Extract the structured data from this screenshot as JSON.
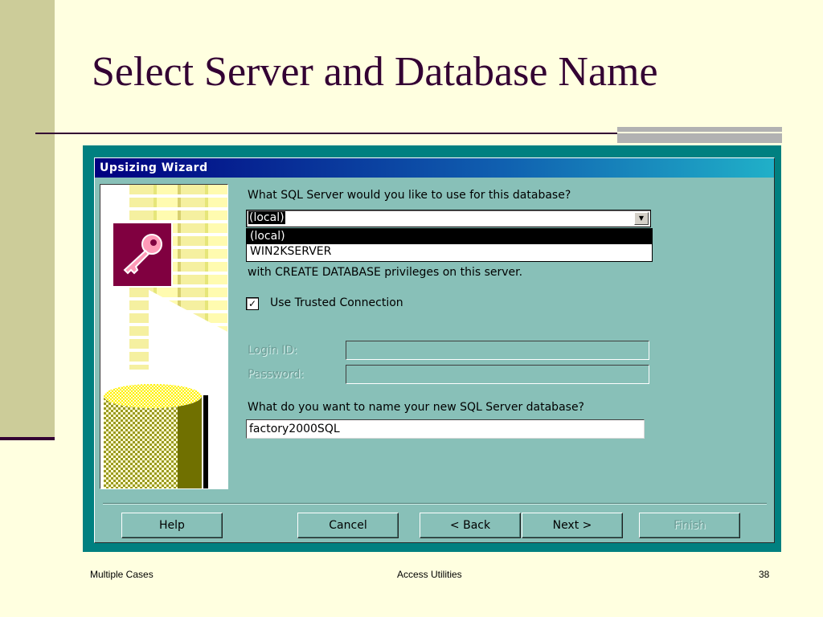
{
  "slide": {
    "title": "Select Server and Database Name",
    "footer_left": "Multiple Cases",
    "footer_center": "Access Utilities",
    "page_number": "38"
  },
  "dialog": {
    "title": "Upsizing  Wizard",
    "server_question": "What SQL Server would you like to use for this database?",
    "server_selected": "(local)",
    "server_options": [
      "(local)",
      "WIN2KSERVER"
    ],
    "privileges_text": "with CREATE DATABASE privileges on this server.",
    "trusted_connection_label": "Use Trusted Connection",
    "trusted_connection_checked": true,
    "login_label": "Login ID:",
    "login_value": "",
    "password_label": "Password:",
    "password_value": "",
    "db_name_question": "What do you want to name your new SQL Server database?",
    "db_name_value": "factory2000SQL",
    "buttons": {
      "help": "Help",
      "cancel": "Cancel",
      "back": "< Back",
      "next": "Next >",
      "finish": "Finish"
    }
  },
  "colors": {
    "slide_background": "#ffffe0",
    "title_color": "#330033",
    "dialog_background": "#88c0b8",
    "titlebar_start": "#000080"
  },
  "icons": [
    "key-icon",
    "database-cylinder-icon",
    "dropdown-arrow-icon",
    "checkmark-icon"
  ]
}
